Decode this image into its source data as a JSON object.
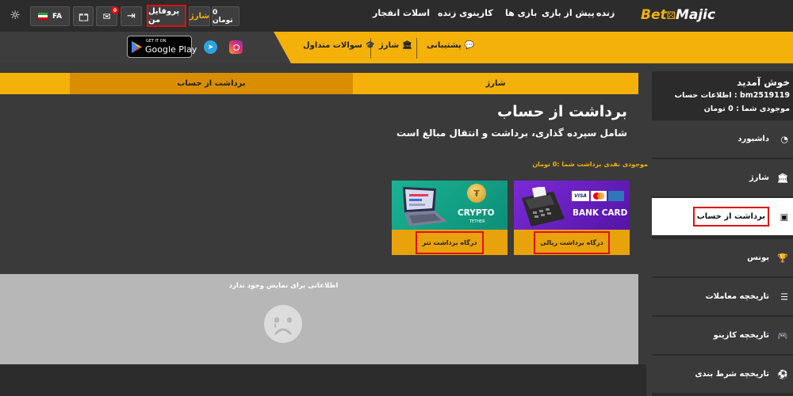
{
  "brand": {
    "logo_left": "Bet",
    "logo_right": "Majic"
  },
  "top_nav": {
    "items": [
      "زنده",
      "پیش از بازی",
      "بازی ها",
      "کازینوی زنده",
      "اسلات",
      "انفجار"
    ]
  },
  "top_actions": {
    "balance": "0 تومان",
    "charge": "شارژ",
    "profile": "پروفایل من",
    "notif_count": "0",
    "lang": "FA"
  },
  "sub_nav": {
    "support": "پشتیبانی",
    "charge": "شارژ",
    "faq": "سوالات متداول",
    "google_small": "GET IT ON",
    "google_big": "Google Play"
  },
  "sidebar": {
    "welcome": "خوش آمدید",
    "account_label": "اطلاعات حساب : bm2519119",
    "balance_label": "موجودی شما : 0 تومان",
    "items": [
      {
        "label": "داشبورد",
        "icon": "dashboard-icon"
      },
      {
        "label": "شارژ",
        "icon": "bank-icon"
      },
      {
        "label": "برداشت از حساب",
        "icon": "wallet-icon"
      },
      {
        "label": "بونس",
        "icon": "trophy-icon"
      },
      {
        "label": "تاریخچه معاملات",
        "icon": "list-icon"
      },
      {
        "label": "تاریخچه کازینو",
        "icon": "gamepad-icon"
      },
      {
        "label": "تاریخچه شرط بندی",
        "icon": "soccer-ball-icon"
      }
    ]
  },
  "tabs": {
    "charge": "شارژ",
    "withdraw": "برداشت از حساب"
  },
  "main": {
    "title": "برداشت از حساب",
    "subtitle": "شامل سپرده گذاری، برداشت و انتقال مبالغ است",
    "cash_balance": "موجودی نقدی برداشت شما :0 تومان"
  },
  "cards": {
    "bank": {
      "img_text": "BANK CARD",
      "visa": "VISA",
      "button": "درگاه برداشت ریالی"
    },
    "crypto": {
      "img_text": "CRYPTO",
      "img_sub": "TETHER",
      "button": "درگاه برداشت تتر"
    }
  },
  "empty": {
    "message": "اطلاعاتی برای نمایش وجود ندارد"
  },
  "colors": {
    "accent": "#f4b10a",
    "dark": "#2c2c2c",
    "panel": "#3a3a3a",
    "highlight_border": "#e01010"
  }
}
